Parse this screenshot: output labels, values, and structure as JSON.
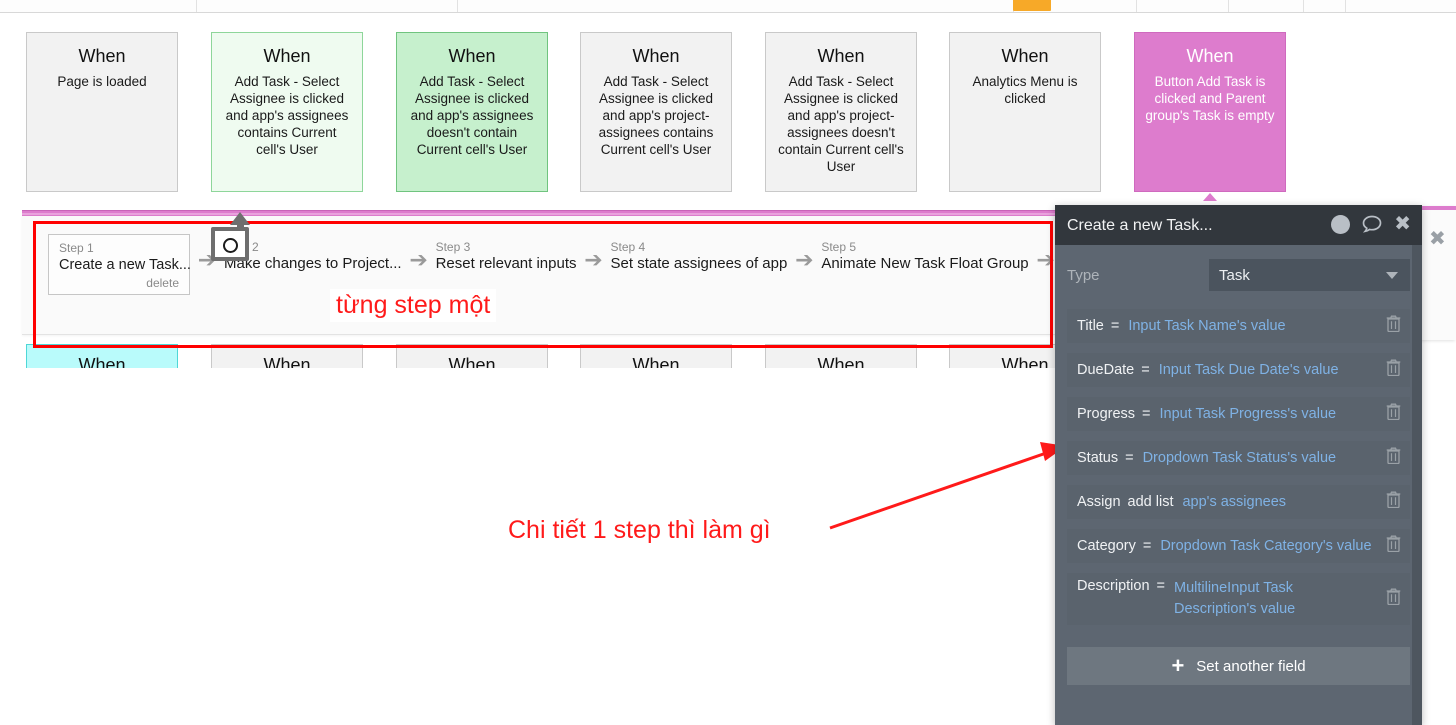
{
  "topbar": {
    "accent_color": "#f7a928",
    "segments": 6
  },
  "workflow": {
    "events": [
      {
        "title": "When",
        "subtitle": "Page is loaded",
        "style": "gray"
      },
      {
        "title": "When",
        "subtitle": "Add Task - Select Assignee is clicked and app's assignees contains Current cell's User",
        "style": "green-light"
      },
      {
        "title": "When",
        "subtitle": "Add Task - Select Assignee is clicked and app's assignees doesn't contain Current cell's User",
        "style": "green"
      },
      {
        "title": "When",
        "subtitle": "Add Task - Select Assignee is clicked and app's project-assignees contains Current cell's User",
        "style": "gray"
      },
      {
        "title": "When",
        "subtitle": "Add Task - Select Assignee is clicked and app's project-assignees doesn't contain Current cell's User",
        "style": "gray"
      },
      {
        "title": "When",
        "subtitle": "Analytics Menu is clicked",
        "style": "gray"
      },
      {
        "title": "When",
        "subtitle": "Button Add Task is clicked and Parent group's Task is empty",
        "style": "magenta"
      }
    ],
    "events_row2": [
      {
        "title": "When",
        "style": "cyan"
      },
      {
        "title": "When",
        "style": "gray"
      },
      {
        "title": "When",
        "style": "gray"
      },
      {
        "title": "When",
        "style": "gray"
      },
      {
        "title": "When",
        "style": "gray"
      },
      {
        "title": "When",
        "style": "gray"
      }
    ],
    "steps": [
      {
        "label": "Step 1",
        "text": "Create a new Task...",
        "delete_label": "delete",
        "selected": true
      },
      {
        "label": "Step 2",
        "text": "Make changes to Project..."
      },
      {
        "label": "Step 3",
        "text": "Reset relevant inputs"
      },
      {
        "label": "Step 4",
        "text": "Set state assignees of app"
      },
      {
        "label": "Step 5",
        "text": "Animate New Task Float Group"
      }
    ],
    "arrow_glyph": "➔"
  },
  "annotations": {
    "color": "#ff1a1a",
    "step_note": "từng step một",
    "detail_note": "Chi tiết 1 step thì làm gì"
  },
  "panel": {
    "title": "Create a new Task...",
    "icons": {
      "help": "?",
      "chat": "chat-icon",
      "close": "✖"
    },
    "type": {
      "label": "Type",
      "value": "Task"
    },
    "fields": [
      {
        "name": "Title",
        "op": "=",
        "value": "Input Task Name's value"
      },
      {
        "name": "DueDate",
        "op": "=",
        "value": "Input Task Due Date's value"
      },
      {
        "name": "Progress",
        "op": "=",
        "value": "Input Task Progress's value"
      },
      {
        "name": "Status",
        "op": "=",
        "value": "Dropdown Task Status's value"
      },
      {
        "name": "Assign",
        "op": "add list",
        "value": "app's assignees"
      },
      {
        "name": "Category",
        "op": "=",
        "value": "Dropdown Task Category's value"
      },
      {
        "name": "Description",
        "op": "=",
        "value": "MultilineInput Task Description's value"
      }
    ],
    "set_another_field": "Set another field",
    "plus_glyph": "+"
  },
  "right_card": {
    "close": "✖"
  }
}
